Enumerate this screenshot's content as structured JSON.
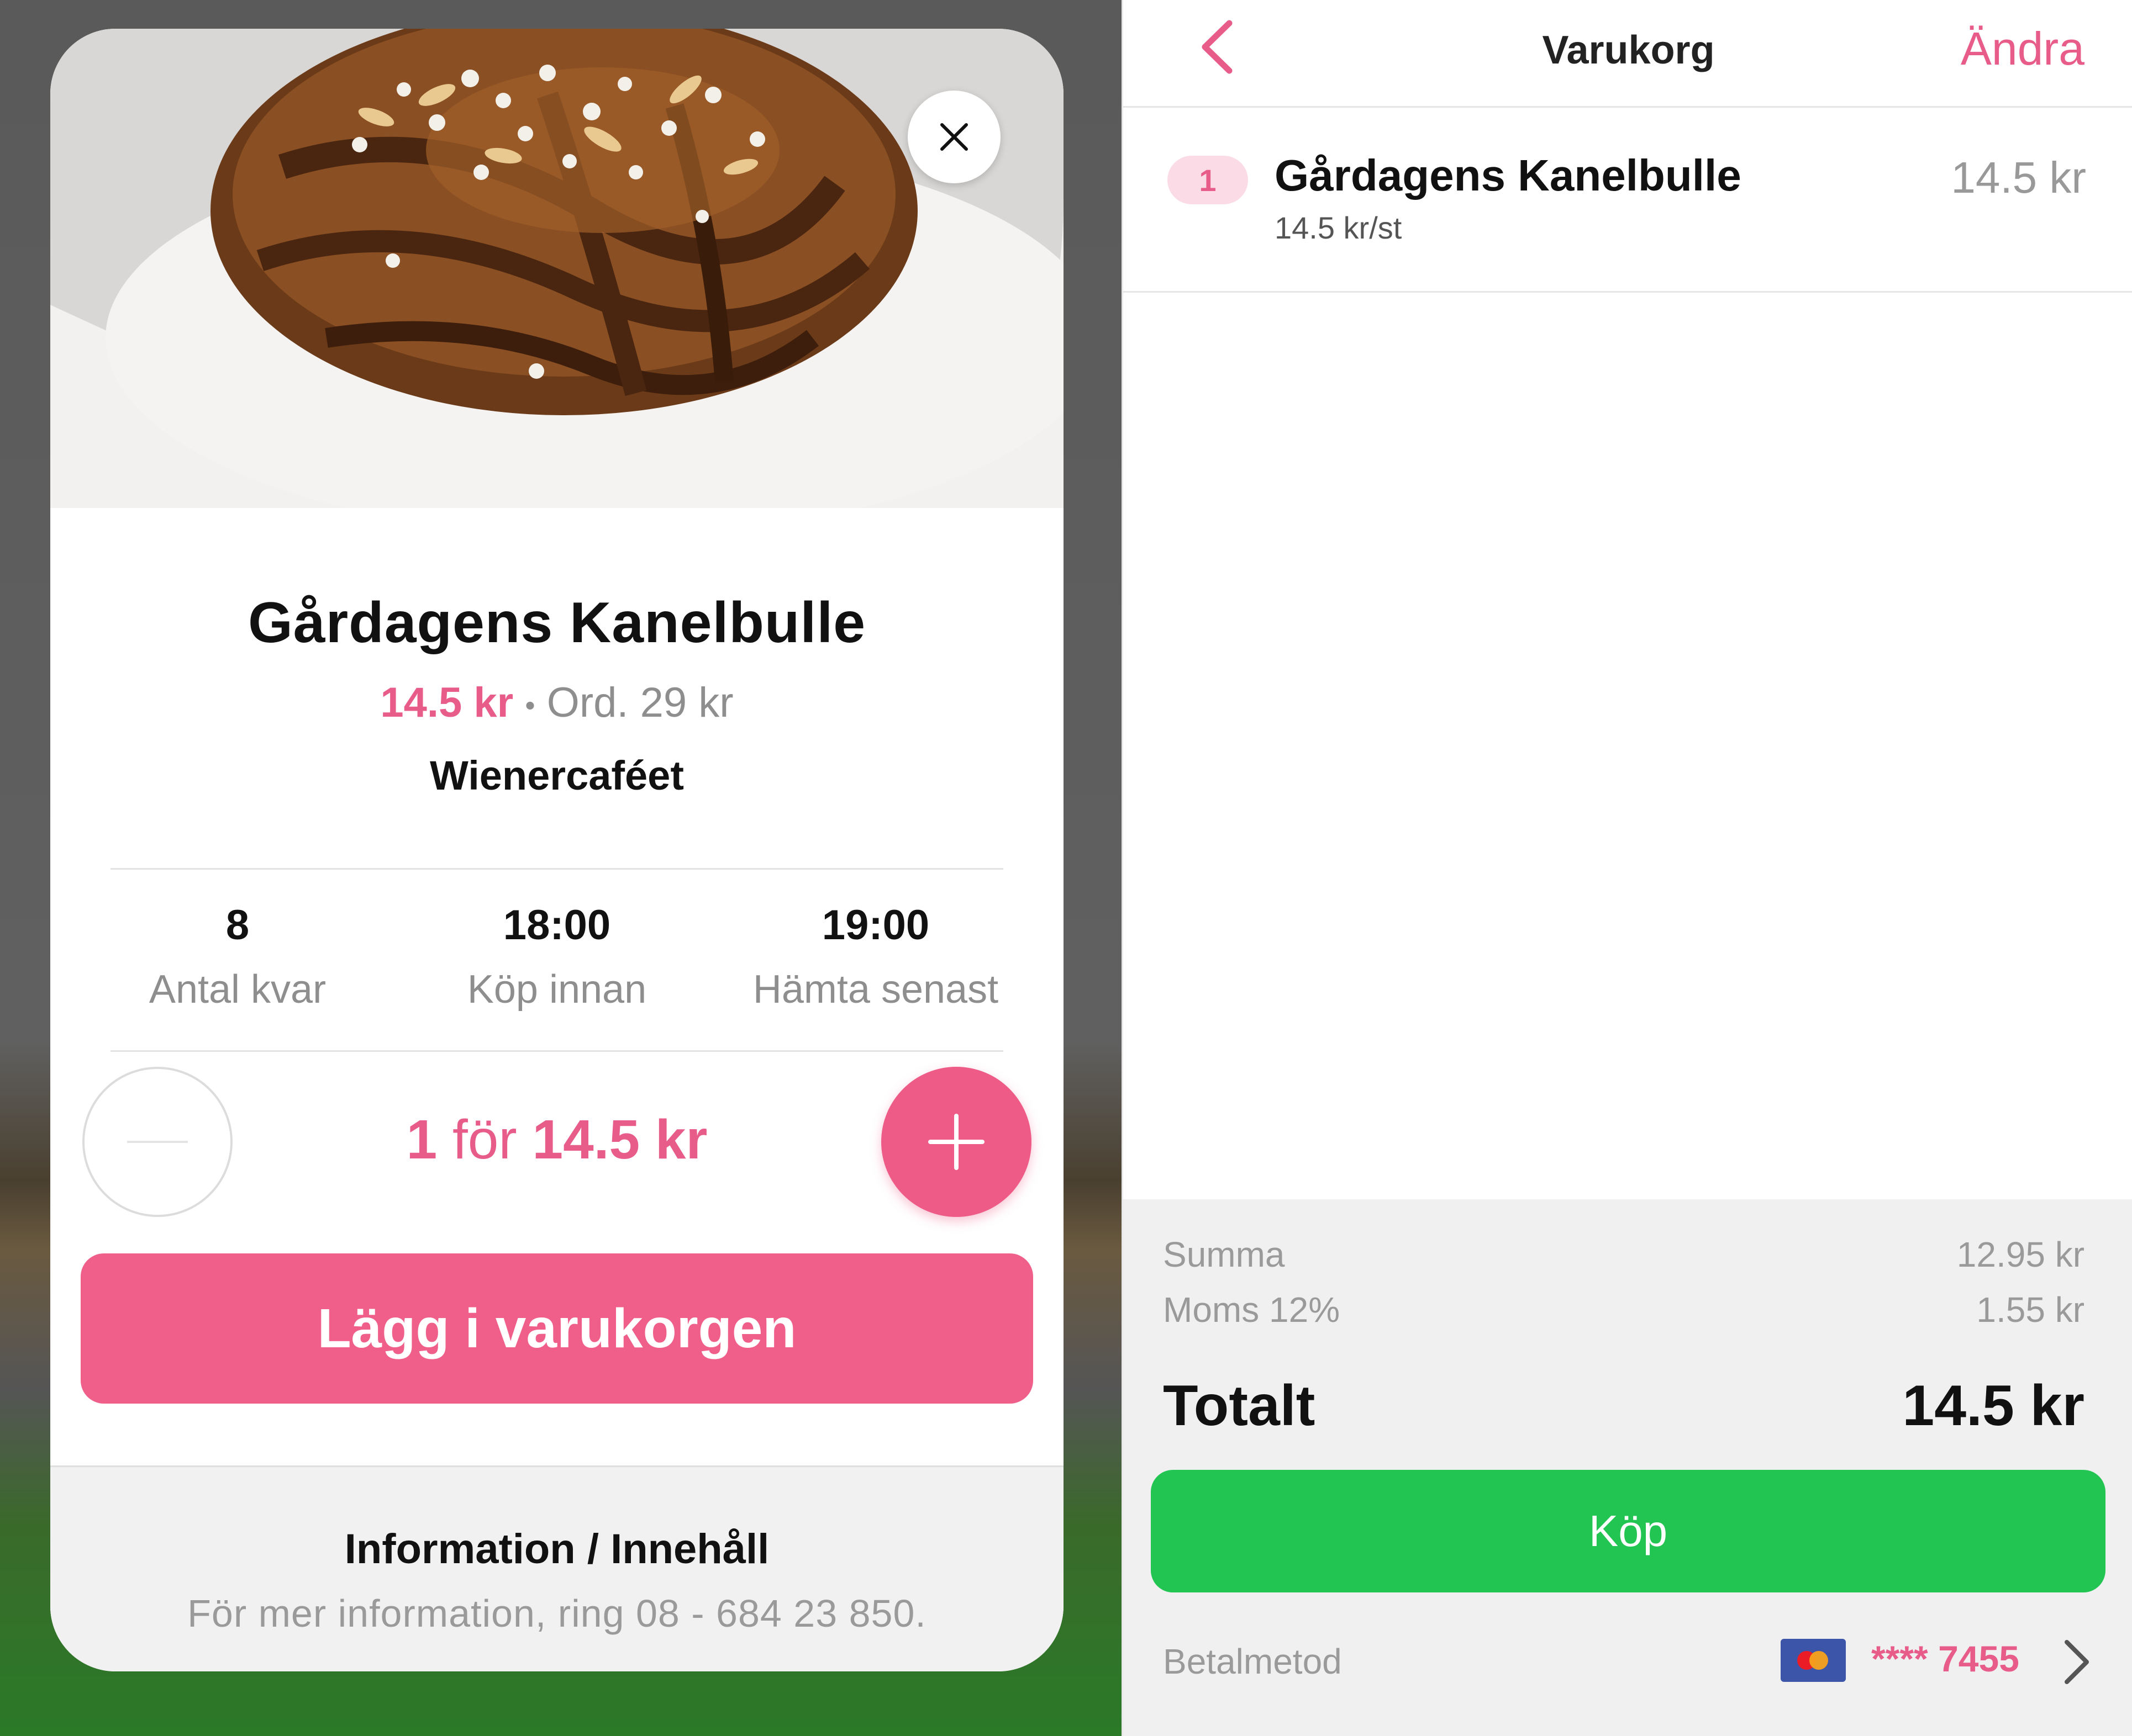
{
  "product": {
    "title": "Gårdagens Kanelbulle",
    "price": "14.5 kr",
    "separator": "•",
    "original_price": "Ord. 29 kr",
    "shop": "Wienercaféet",
    "stats": [
      {
        "value": "8",
        "label": "Antal kvar"
      },
      {
        "value": "18:00",
        "label": "Köp innan"
      },
      {
        "value": "19:00",
        "label": "Hämta senast"
      }
    ],
    "quantity": "1",
    "quantity_for": "för",
    "quantity_total": "14.5 kr",
    "add_to_cart_label": "Lägg i varukorgen",
    "info_title": "Information / Innehåll",
    "info_text": "För mer information, ring 08 - 684 23 850.",
    "icons": {
      "close": "close-icon",
      "minus": "minus-icon",
      "plus": "plus-icon"
    }
  },
  "cart": {
    "title": "Varukorg",
    "edit_label": "Ändra",
    "item": {
      "quantity": "1",
      "name": "Gårdagens Kanelbulle",
      "unit_price": "14.5 kr/st",
      "price": "14.5 kr"
    },
    "summary": {
      "summa_label": "Summa",
      "summa_value": "12.95 kr",
      "moms_label": "Moms 12%",
      "moms_value": "1.55 kr",
      "total_label": "Totalt",
      "total_value": "14.5 kr"
    },
    "buy_label": "Köp",
    "payment": {
      "label": "Betalmetod",
      "card_number": "**** 7455",
      "card_icon": "mastercard-icon"
    },
    "icons": {
      "back": "chevron-left-icon",
      "forward": "chevron-right-icon"
    }
  },
  "colors": {
    "accent_pink": "#e85c8a",
    "buy_green": "#22c552",
    "summary_bg": "#f0f0f1"
  }
}
